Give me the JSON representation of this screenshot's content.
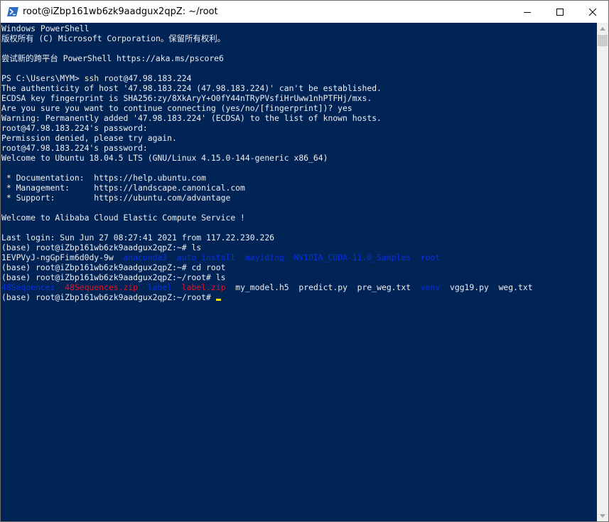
{
  "window": {
    "title": "root@iZbp161wb6zk9aadgux2qpZ: ~/root"
  },
  "terminal": {
    "lines": [
      "Windows PowerShell",
      "版权所有 (C) Microsoft Corporation。保留所有权利。",
      "",
      "尝试新的跨平台 PowerShell https://aka.ms/pscore6",
      "",
      "",
      "The authenticity of host '47.98.183.224 (47.98.183.224)' can't be established.",
      "ECDSA key fingerprint is SHA256:zy/8XkAryY+O0fY44nTRyPVsfiHrUww1nhPTFHj/mxs.",
      "Are you sure you want to continue connecting (yes/no/[fingerprint])? yes",
      "Warning: Permanently added '47.98.183.224' (ECDSA) to the list of known hosts.",
      "root@47.98.183.224's password:",
      "Permission denied, please try again.",
      "root@47.98.183.224's password:",
      "Welcome to Ubuntu 18.04.5 LTS (GNU/Linux 4.15.0-144-generic x86_64)",
      "",
      " * Documentation:  https://help.ubuntu.com",
      " * Management:     https://landscape.canonical.com",
      " * Support:        https://ubuntu.com/advantage",
      "",
      "Welcome to Alibaba Cloud Elastic Compute Service !",
      "",
      "Last login: Sun Jun 27 08:27:41 2021 from 117.22.230.226",
      "(base) root@iZbp161wb6zk9aadgux2qpZ:~# ls",
      "",
      "(base) root@iZbp161wb6zk9aadgux2qpZ:~# cd root",
      "(base) root@iZbp161wb6zk9aadgux2qpZ:~/root# ls",
      "",
      "(base) root@iZbp161wb6zk9aadgux2qpZ:~/root# "
    ],
    "ssh_prompt": "PS C:\\Users\\MYM> ",
    "ssh_command": "ssh",
    "ssh_args": " root@47.98.183.224",
    "home_listing": {
      "file": "1EVPVyJ-ngGpFim6d0dy-9w",
      "dirs": [
        "anaconda3",
        "auto_install",
        "mayiding",
        "NVIDIA_CUDA-11.0_Samples",
        "root"
      ]
    },
    "root_listing": [
      {
        "name": "48Sequences",
        "kind": "dir"
      },
      {
        "name": "48Sequences.zip",
        "kind": "zip"
      },
      {
        "name": "label",
        "kind": "dir"
      },
      {
        "name": "label.zip",
        "kind": "zip"
      },
      {
        "name": "my_model.h5",
        "kind": "file"
      },
      {
        "name": "predict.py",
        "kind": "file"
      },
      {
        "name": "pre_weg.txt",
        "kind": "file"
      },
      {
        "name": "venv",
        "kind": "dir"
      },
      {
        "name": "vgg19.py",
        "kind": "file"
      },
      {
        "name": "weg.txt",
        "kind": "file"
      }
    ]
  },
  "colors": {
    "background": "#012456",
    "foreground": "#eeedf0",
    "command": "#f9f1a5",
    "directory": "#0a2fe0",
    "archive": "#e81123",
    "cursor": "#fce100"
  }
}
